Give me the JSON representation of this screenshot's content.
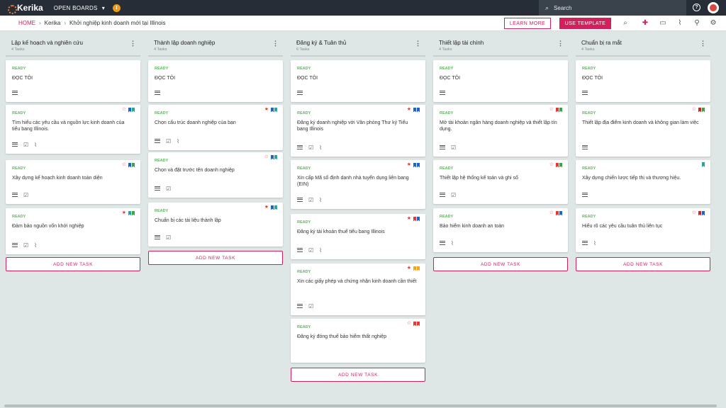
{
  "topbar": {
    "logo": "Kerika",
    "open_boards": "OPEN BOARDS",
    "org_badge": "I",
    "search_placeholder": "Search",
    "help": "?"
  },
  "breadcrumb": {
    "home": "HOME",
    "org": "Kerika",
    "board": "Khởi nghiệp kinh doanh mới tại Illinois"
  },
  "actions": {
    "learn_more": "LEARN MORE",
    "use_template": "USE TEMPLATE"
  },
  "colors": {
    "accent": "#d0215c",
    "ready": "#5cb85c",
    "red": "#e53935",
    "blue": "#1e63c7",
    "green": "#43a047",
    "teal": "#26a69a",
    "orange": "#f5a623",
    "darkred": "#c62828"
  },
  "add_task_label": "ADD NEW TASK",
  "columns": [
    {
      "title": "Lập kế hoạch và nghiên cứu",
      "count": "4 Tasks",
      "cards": [
        {
          "status": "READY",
          "title": "ĐỌC TÔI"
        },
        {
          "status": "READY",
          "title": "Tìm hiểu các yêu cầu và nguồn lực kinh doanh của tiểu bang Illinois."
        },
        {
          "status": "READY",
          "title": "Xây dựng kế hoạch kinh doanh toàn diện"
        },
        {
          "status": "READY",
          "title": "Đảm bảo nguồn vốn khởi nghiệp"
        }
      ]
    },
    {
      "title": "Thành lập doanh nghiệp",
      "count": "4 Tasks",
      "cards": [
        {
          "status": "READY",
          "title": "ĐỌC TÔI"
        },
        {
          "status": "READY",
          "title": "Chọn cấu trúc doanh nghiệp của bạn"
        },
        {
          "status": "READY",
          "title": "Chọn và đặt trước tên doanh nghiệp"
        },
        {
          "status": "READY",
          "title": "Chuẩn bị các tài liệu thành lập"
        }
      ]
    },
    {
      "title": "Đăng ký & Tuân thủ",
      "count": "6 Tasks",
      "cards": [
        {
          "status": "READY",
          "title": "ĐỌC TÔI"
        },
        {
          "status": "READY",
          "title": "Đăng ký doanh nghiệp với Văn phòng Thư ký Tiểu bang Illinois"
        },
        {
          "status": "READY",
          "title": "Xin cấp Mã số định danh nhà tuyển dụng liên bang (EIN)"
        },
        {
          "status": "READY",
          "title": "Đăng ký tài khoản thuế tiểu bang Illinois"
        },
        {
          "status": "READY",
          "title": "Xin các giấy phép và chứng nhận kinh doanh cần thiết"
        },
        {
          "status": "READY",
          "title": "Đăng ký đóng thuế bảo hiểm thất nghiệp"
        }
      ]
    },
    {
      "title": "Thiết lập tài chính",
      "count": "4 Tasks",
      "cards": [
        {
          "status": "READY",
          "title": "ĐỌC TÔI"
        },
        {
          "status": "READY",
          "title": "Mở tài khoản ngân hàng doanh nghiệp và thiết lập tín dụng."
        },
        {
          "status": "READY",
          "title": "Thiết lập hệ thống kế toán và ghi sổ"
        },
        {
          "status": "READY",
          "title": "Bảo hiểm kinh doanh an toàn"
        }
      ]
    },
    {
      "title": "Chuẩn bị ra mắt",
      "count": "4 Tasks",
      "cards": [
        {
          "status": "READY",
          "title": "ĐỌC TÔI"
        },
        {
          "status": "READY",
          "title": "Thiết lập địa điểm kinh doanh và không gian làm việc"
        },
        {
          "status": "READY",
          "title": "Xây dựng chiến lược tiếp thị và thương hiệu."
        },
        {
          "status": "READY",
          "title": "Hiểu rõ các yêu cầu tuân thủ liên tục"
        }
      ]
    }
  ]
}
